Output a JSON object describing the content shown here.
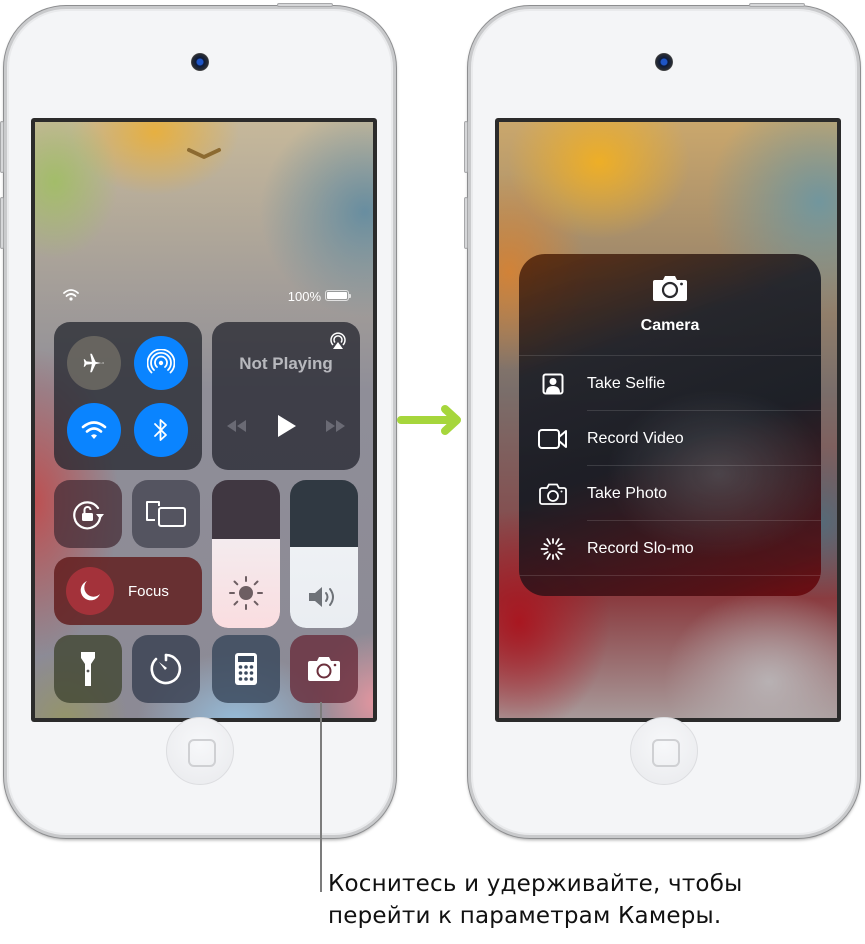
{
  "left_device": {
    "status_bar": {
      "battery_percent": "100%",
      "wifi": "wifi-icon",
      "battery_level": 1.0
    },
    "control_center": {
      "connectivity": [
        {
          "name": "airplane-mode",
          "icon": "airplane-icon",
          "state": "off"
        },
        {
          "name": "airdrop",
          "icon": "airdrop-icon",
          "state": "on"
        },
        {
          "name": "wifi",
          "icon": "wifi-icon",
          "state": "on"
        },
        {
          "name": "bluetooth",
          "icon": "bluetooth-icon",
          "state": "on"
        }
      ],
      "media": {
        "status": "Not Playing",
        "controls": [
          "rewind",
          "play",
          "fast-forward"
        ]
      },
      "orientation_lock": {
        "icon": "orientation-lock-icon"
      },
      "screen_mirroring": {
        "icon": "screen-mirroring-icon"
      },
      "focus": {
        "label": "Focus",
        "icon": "moon-icon"
      },
      "brightness": {
        "level": 0.6,
        "icon": "sun-icon"
      },
      "volume": {
        "level": 0.55,
        "icon": "speaker-icon"
      },
      "bottom_row": [
        {
          "name": "flashlight",
          "icon": "flashlight-icon"
        },
        {
          "name": "timer",
          "icon": "timer-icon"
        },
        {
          "name": "calculator",
          "icon": "calculator-icon"
        },
        {
          "name": "camera",
          "icon": "camera-icon"
        }
      ]
    }
  },
  "right_device": {
    "camera_menu": {
      "title": "Camera",
      "items": [
        {
          "label": "Take Selfie",
          "icon": "selfie-icon"
        },
        {
          "label": "Record Video",
          "icon": "video-icon"
        },
        {
          "label": "Take Photo",
          "icon": "camera-icon"
        },
        {
          "label": "Record Slo-mo",
          "icon": "slomo-icon"
        }
      ]
    }
  },
  "arrow_color": "#a6d63c",
  "callout": {
    "line1": "Коснитесь и удерживайте, чтобы",
    "line2": "перейти к параметрам Камеры."
  }
}
